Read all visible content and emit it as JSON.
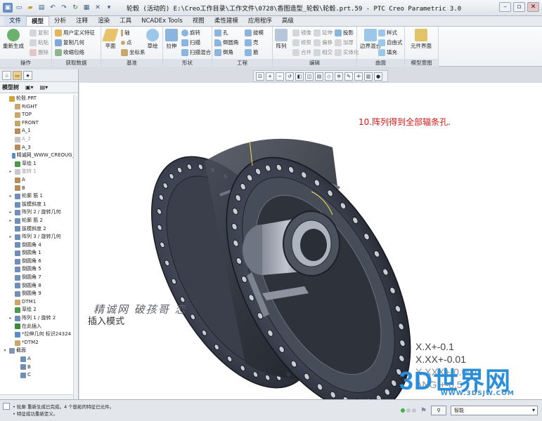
{
  "window": {
    "title": "轮毂 (活动的) E:\\Creo工作目录\\工作文件\\0728\\香图造型_轮毂\\轮毂.prt.59 - PTC Creo Parametric 3.0"
  },
  "menu_tabs": [
    "文件",
    "模型",
    "分析",
    "注释",
    "渲染",
    "工具",
    "NCADEx Tools",
    "视图",
    "柔性建模",
    "应用程序",
    "高级"
  ],
  "active_tab": "模型",
  "ribbon": {
    "operations": {
      "label": "操作",
      "regen": "重新生成",
      "copy": "复制",
      "paste": "粘贴",
      "delete": "删除"
    },
    "get_data": {
      "label": "获取数据",
      "udf": "用户定义特征",
      "copy_geom": "复制几何",
      "shrinkwrap": "收缩包络"
    },
    "datum": {
      "label": "基准",
      "plane": "平面",
      "axis": "轴",
      "point": "点",
      "csys": "坐标系",
      "sketch": "草绘"
    },
    "shapes": {
      "label": "形状",
      "extrude": "拉伸",
      "revolve": "旋转",
      "sweep": "扫描",
      "swept_blend": "扫描混合"
    },
    "engineering": {
      "label": "工程",
      "hole": "孔",
      "round": "倒圆角",
      "chamfer": "倒角",
      "draft": "拔模",
      "shell": "壳",
      "rib": "筋"
    },
    "editing": {
      "label": "编辑",
      "pattern": "阵列",
      "mirror": "镜像",
      "extend": "延伸",
      "project": "投影",
      "trim": "修剪",
      "offset": "偏移",
      "thicken": "加厚",
      "merge": "合并",
      "intersect": "相交",
      "solidify": "实体化"
    },
    "surfaces": {
      "label": "曲面",
      "boundary": "边界混合",
      "style": "样式",
      "freestyle": "自由式",
      "fill": "填充"
    },
    "intent": {
      "label": "模型意图",
      "component_interface": "元件界面"
    }
  },
  "model_tree": {
    "header": "模型树",
    "items": [
      {
        "label": "轮毂.PRT",
        "indent": 0,
        "exp": "",
        "color": "#d8a23a",
        "grey": false
      },
      {
        "label": "RIGHT",
        "indent": 1,
        "exp": "",
        "color": "#c9a66b",
        "grey": false
      },
      {
        "label": "TOP",
        "indent": 1,
        "exp": "",
        "color": "#c9a66b",
        "grey": false
      },
      {
        "label": "FRONT",
        "indent": 1,
        "exp": "",
        "color": "#c9a66b",
        "grey": false
      },
      {
        "label": "A_1",
        "indent": 1,
        "exp": "",
        "color": "#b58c5a",
        "grey": false
      },
      {
        "label": "A_2",
        "indent": 1,
        "exp": "",
        "color": "#c7c7c7",
        "grey": true
      },
      {
        "label": "A_3",
        "indent": 1,
        "exp": "",
        "color": "#b58c5a",
        "grey": false
      },
      {
        "label": "精诚网_WWW_CREOUG_C",
        "indent": 1,
        "exp": "",
        "color": "#5b8cc9",
        "grey": false
      },
      {
        "label": "草绘 1",
        "indent": 1,
        "exp": "",
        "color": "#4a9a4a",
        "grey": false
      },
      {
        "label": "旋转 1",
        "indent": 1,
        "exp": "▸",
        "color": "#c7c7c7",
        "grey": true
      },
      {
        "label": "A",
        "indent": 1,
        "exp": "",
        "color": "#b58c5a",
        "grey": false
      },
      {
        "label": "B",
        "indent": 1,
        "exp": "",
        "color": "#b58c5a",
        "grey": false
      },
      {
        "label": "轮廓 筋 1",
        "indent": 1,
        "exp": "▸",
        "color": "#6f8fb8",
        "grey": false
      },
      {
        "label": "拔模斜度 1",
        "indent": 1,
        "exp": "",
        "color": "#6f8fb8",
        "grey": false
      },
      {
        "label": "阵列 2 / 旋转几何",
        "indent": 1,
        "exp": "▸",
        "color": "#6f8fb8",
        "grey": false
      },
      {
        "label": "轮廓 筋 2",
        "indent": 1,
        "exp": "▸",
        "color": "#6f8fb8",
        "grey": false
      },
      {
        "label": "拔模斜度 2",
        "indent": 1,
        "exp": "",
        "color": "#6f8fb8",
        "grey": false
      },
      {
        "label": "阵列 3 / 旋转几何",
        "indent": 1,
        "exp": "▸",
        "color": "#6f8fb8",
        "grey": false
      },
      {
        "label": "倒圆角 4",
        "indent": 1,
        "exp": "",
        "color": "#6f8fb8",
        "grey": false
      },
      {
        "label": "倒圆角 1",
        "indent": 1,
        "exp": "",
        "color": "#6f8fb8",
        "grey": false
      },
      {
        "label": "倒圆角 6",
        "indent": 1,
        "exp": "",
        "color": "#6f8fb8",
        "grey": false
      },
      {
        "label": "倒圆角 5",
        "indent": 1,
        "exp": "",
        "color": "#6f8fb8",
        "grey": false
      },
      {
        "label": "倒圆角 7",
        "indent": 1,
        "exp": "",
        "color": "#6f8fb8",
        "grey": false
      },
      {
        "label": "倒圆角 8",
        "indent": 1,
        "exp": "",
        "color": "#6f8fb8",
        "grey": false
      },
      {
        "label": "倒圆角 9",
        "indent": 1,
        "exp": "",
        "color": "#6f8fb8",
        "grey": false
      },
      {
        "label": "DTM1",
        "indent": 1,
        "exp": "",
        "color": "#c9a66b",
        "grey": false
      },
      {
        "label": "草绘 2",
        "indent": 1,
        "exp": "",
        "color": "#4a9a4a",
        "grey": false
      },
      {
        "label": "阵列 1 / 旋转 2",
        "indent": 1,
        "exp": "▸",
        "color": "#6f8fb8",
        "grey": false
      },
      {
        "label": "在此插入",
        "indent": 1,
        "exp": "",
        "color": "#3a8a3a",
        "grey": false
      },
      {
        "label": "*拉伸几何 标识24324",
        "indent": 1,
        "exp": "",
        "color": "#5b8cc9",
        "grey": false
      },
      {
        "label": "*DTM2",
        "indent": 1,
        "exp": "",
        "color": "#c9a66b",
        "grey": false
      },
      {
        "label": "截面",
        "indent": 0,
        "exp": "▾",
        "color": "#7f94b0",
        "grey": false
      },
      {
        "label": "A",
        "indent": 2,
        "exp": "",
        "color": "#6f8fb8",
        "grey": false
      },
      {
        "label": "B",
        "indent": 2,
        "exp": "",
        "color": "#6f8fb8",
        "grey": false
      },
      {
        "label": "C",
        "indent": 2,
        "exp": "",
        "color": "#6f8fb8",
        "grey": false
      }
    ]
  },
  "viewport": {
    "note": "10.阵列得到全部辐条孔.",
    "watermark": "精诚网 破孩哥  恋",
    "mode": "插入模式",
    "tolerances": [
      "X.X+-0.1",
      "X.XX+-0.01",
      "X.XXX+-0.001",
      "ANG.+-0.5"
    ],
    "logo": "3D世界网",
    "logo_url": "WWW.3DSJW.COM"
  },
  "status": {
    "message1": "• 轮廓 重新生成已完成。4 个筋拓的特征已元件。",
    "message2": "• 特征成功重新定义。",
    "filter": "智能"
  }
}
